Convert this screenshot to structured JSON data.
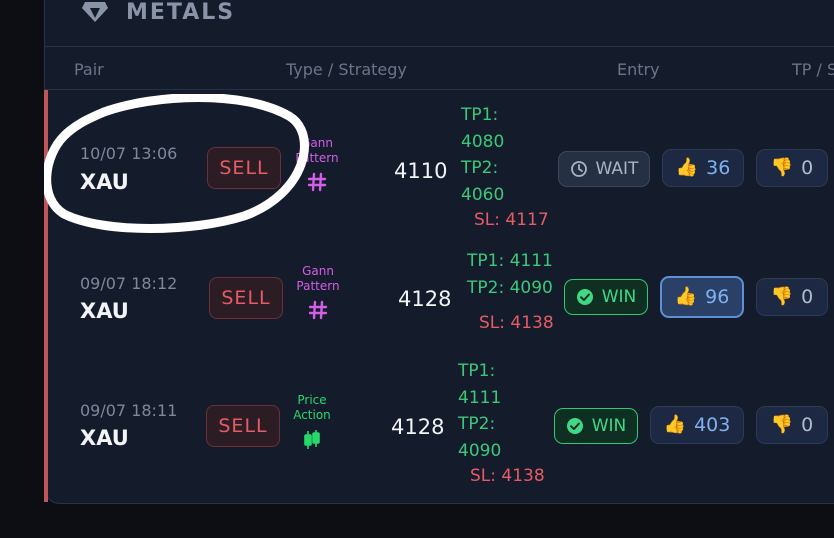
{
  "section": {
    "title": "METALS",
    "icon": "gem-icon"
  },
  "columns": [
    "Pair",
    "Type / Strategy",
    "Entry",
    "TP / S"
  ],
  "rows": [
    {
      "date": "10/07 13:06",
      "pair": "XAU",
      "type": "SELL",
      "strategy": "Gann Pattern",
      "strategy_icon": "hash-icon",
      "entry": "4110",
      "tp1_label": "TP1:",
      "tp1": "4080",
      "tp2_label": "TP2:",
      "tp2": "4060",
      "sl": "SL: 4117",
      "status": "WAIT",
      "up": "36",
      "down": "0"
    },
    {
      "date": "09/07 18:12",
      "pair": "XAU",
      "type": "SELL",
      "strategy": "Gann Pattern",
      "strategy_icon": "hash-icon",
      "entry": "4128",
      "tp1": "TP1: 4111",
      "tp2": "TP2: 4090",
      "sl": "SL: 4138",
      "status": "WIN",
      "up": "96",
      "down": "0"
    },
    {
      "date": "09/07 18:11",
      "pair": "XAU",
      "type": "SELL",
      "strategy": "Price Action",
      "strategy_icon": "candlestick-icon",
      "entry": "4128",
      "tp1_label": "TP1:",
      "tp1": "4111",
      "tp2_label": "TP2:",
      "tp2": "4090",
      "sl": "SL: 4138",
      "status": "WIN",
      "up": "403",
      "down": "0"
    }
  ],
  "colors": {
    "sell": "#e55c66",
    "tp": "#3bc979",
    "gann": "#d35ee8",
    "price_action": "#26d86c",
    "win": "#40d884",
    "accent": "#c2545c"
  }
}
